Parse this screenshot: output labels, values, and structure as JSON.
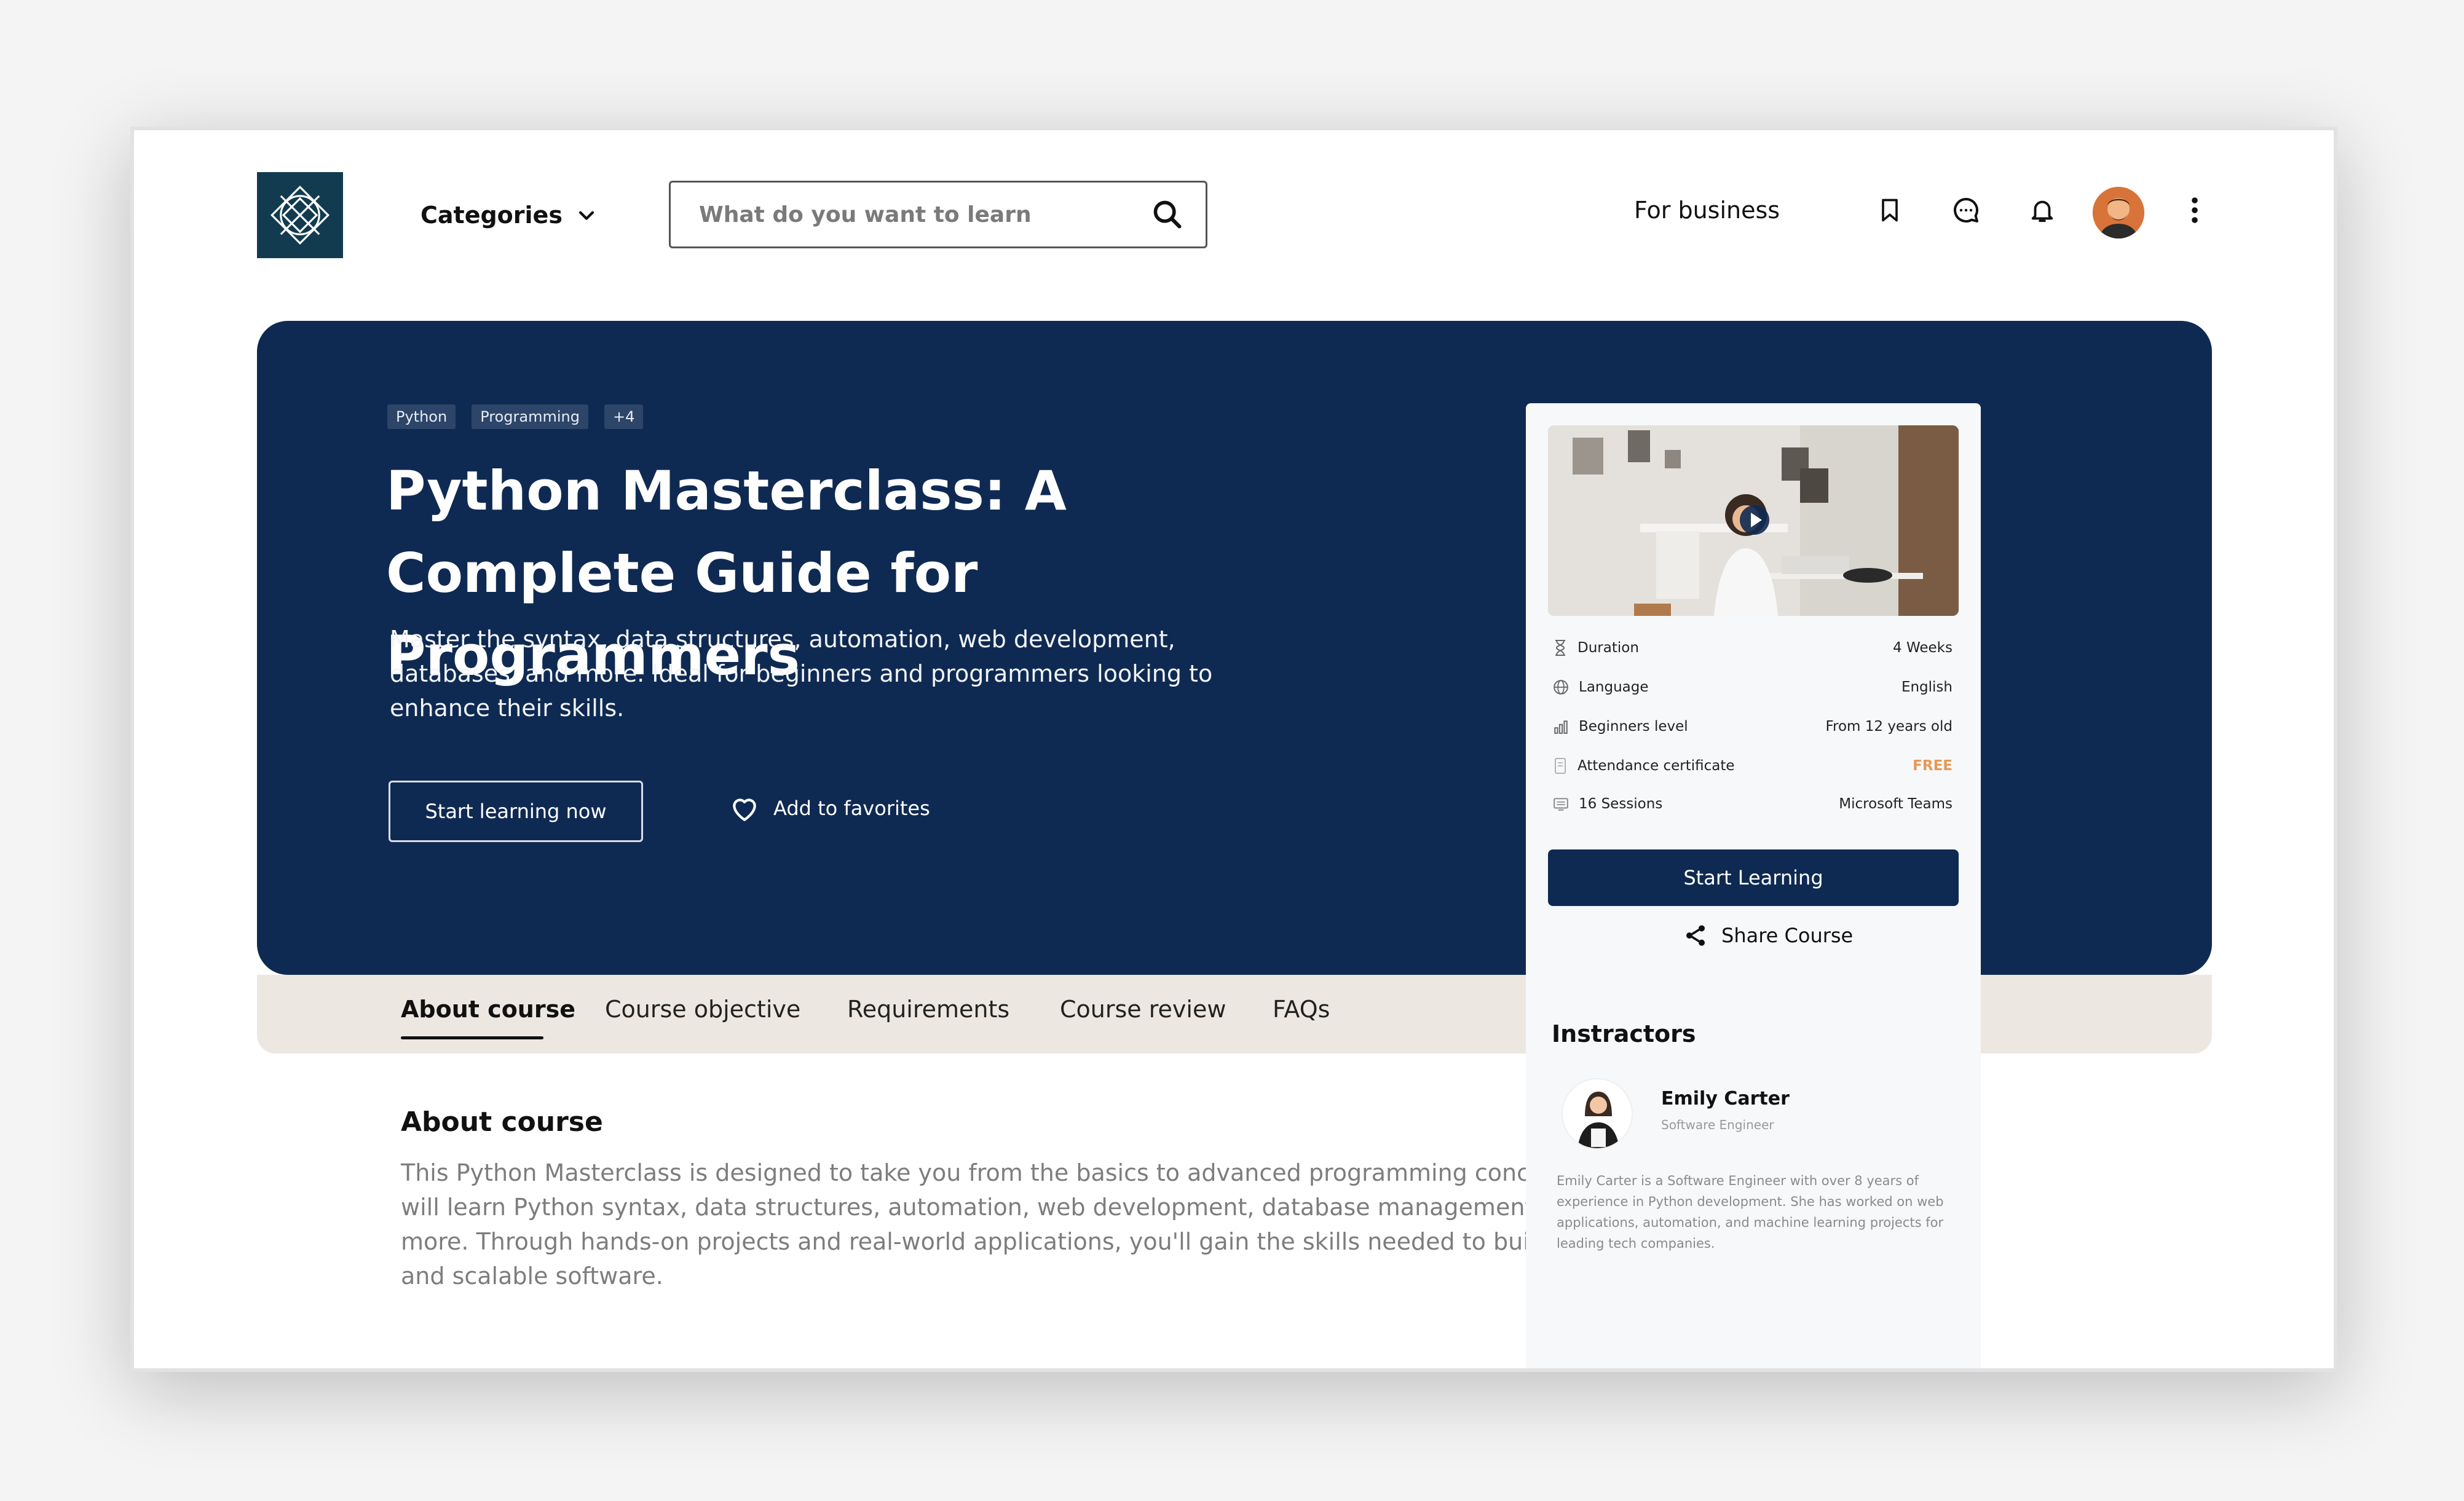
{
  "header": {
    "categories_label": "Categories",
    "search_placeholder": "What do you want to learn",
    "for_business": "For business"
  },
  "hero": {
    "tags": [
      "Python",
      "Programming",
      "+4"
    ],
    "title": "Python Masterclass: A Complete Guide for Programmers",
    "description": "Master the syntax, data structures, automation, web development, databases, and more. Ideal for beginners and programmers looking to enhance their skills.",
    "start_button": "Start learning now",
    "favorites": "Add to favorites"
  },
  "tabs": [
    {
      "label": "About course",
      "active": true
    },
    {
      "label": "Course objective",
      "active": false
    },
    {
      "label": "Requirements",
      "active": false
    },
    {
      "label": "Course review",
      "active": false
    },
    {
      "label": "FAQs",
      "active": false
    }
  ],
  "about": {
    "heading": "About course",
    "body": "This Python Masterclass is designed to take you from the basics to advanced programming concepts. You will learn Python syntax, data structures, automation, web development, database management, and more. Through hands-on projects and real-world applications, you'll gain the skills needed to build efficient and scalable software."
  },
  "card": {
    "details": [
      {
        "icon": "hourglass-icon",
        "label": "Duration",
        "value": "4 Weeks"
      },
      {
        "icon": "globe-icon",
        "label": "Language",
        "value": "English"
      },
      {
        "icon": "level-icon",
        "label": "Beginners level",
        "value": "From 12 years old"
      },
      {
        "icon": "certificate-icon",
        "label": "Attendance certificate",
        "value": "FREE"
      },
      {
        "icon": "sessions-icon",
        "label": "16 Sessions",
        "value": "Microsoft Teams"
      }
    ],
    "start_button": "Start Learning",
    "share": "Share Course"
  },
  "instructors": {
    "heading": "Instractors",
    "name": "Emily Carter",
    "role": "Software Engineer",
    "bio": "Emily Carter is a Software Engineer with over 8 years of experience in Python development. She has worked on web applications, automation, and machine learning projects for leading tech companies."
  },
  "colors": {
    "primary": "#0f2a52",
    "tab_bar": "#ece8e1",
    "free_accent": "#e59a55"
  }
}
